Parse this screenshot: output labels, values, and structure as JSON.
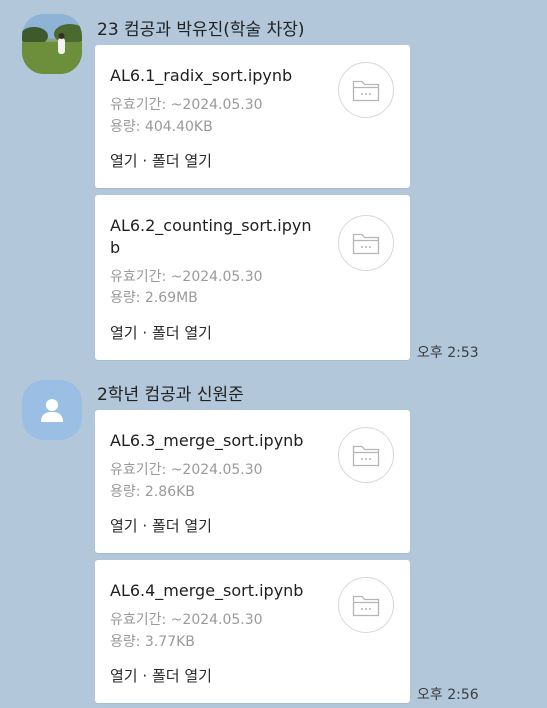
{
  "groups": [
    {
      "sender": "23 컴공과 박유진(학술 차장)",
      "time": "오후 2:53",
      "files": [
        {
          "name": "AL6.1_radix_sort.ipynb",
          "expiry": "유효기간: ~2024.05.30",
          "size": "용량: 404.40KB",
          "open": "열기",
          "sep": "·",
          "open_folder": "폴더 열기"
        },
        {
          "name": "AL6.2_counting_sort.ipynb",
          "expiry": "유효기간: ~2024.05.30",
          "size": "용량: 2.69MB",
          "open": "열기",
          "sep": "·",
          "open_folder": "폴더 열기"
        }
      ]
    },
    {
      "sender": "2학년 컴공과 신원준",
      "time": "오후 2:56",
      "files": [
        {
          "name": "AL6.3_merge_sort.ipynb",
          "expiry": "유효기간: ~2024.05.30",
          "size": "용량: 2.86KB",
          "open": "열기",
          "sep": "·",
          "open_folder": "폴더 열기"
        },
        {
          "name": "AL6.4_merge_sort.ipynb",
          "expiry": "유효기간: ~2024.05.30",
          "size": "용량: 3.77KB",
          "open": "열기",
          "sep": "·",
          "open_folder": "폴더 열기"
        }
      ]
    }
  ],
  "colors": {
    "background": "#b2c7da",
    "card": "#ffffff",
    "meta_text": "#9a9a9a",
    "default_avatar": "#9bbfe4"
  },
  "icons": {
    "file": "folder-icon",
    "default_avatar": "person-icon"
  }
}
